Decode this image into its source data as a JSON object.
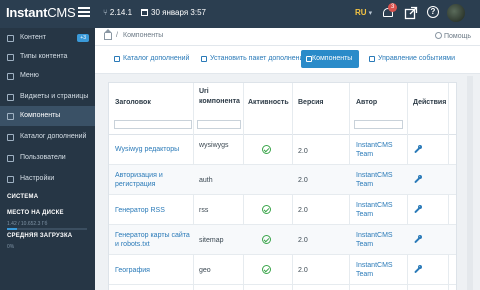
{
  "topbar": {
    "logo_main": "Instant",
    "logo_sub": "CMS",
    "version": "2.14.1",
    "date": "30 января 3:57",
    "language": "RU",
    "notifications_count": "3"
  },
  "sidebar": {
    "items": [
      {
        "label": "Контент",
        "badge": "+3"
      },
      {
        "label": "Типы контента"
      },
      {
        "label": "Меню"
      },
      {
        "label": "Виджеты и страницы"
      },
      {
        "label": "Компоненты"
      },
      {
        "label": "Каталог дополнений"
      },
      {
        "label": "Пользователи"
      },
      {
        "label": "Настройки"
      }
    ],
    "system_title": "СИСТЕМА",
    "disk_title": "МЕСТО НА ДИСКЕ",
    "disk_value": "1.42 / 10.652.3 Гб",
    "disk_fraction": 0.13,
    "load_title": "СРЕДНЯЯ ЗАГРУЗКА",
    "load_value": "0%",
    "load_fraction": 0.0
  },
  "breadcrumb": {
    "separator": "/",
    "current": "Компоненты",
    "help": "Помощь"
  },
  "tabs": [
    {
      "label": "Каталог дополнений"
    },
    {
      "label": "Установить пакет дополнения"
    },
    {
      "label": "Компоненты"
    },
    {
      "label": "Управление событиями"
    }
  ],
  "table": {
    "headers": {
      "title": "Заголовок",
      "uri": "Uri компонента",
      "active": "Активность",
      "version": "Версия",
      "author": "Автор",
      "actions": "Действия"
    },
    "rows": [
      {
        "title": "Wysiwyg редакторы",
        "uri": "wysiwygs",
        "active": true,
        "version": "2.0",
        "author": "InstantCMS Team"
      },
      {
        "title": "Авторизация и регистрация",
        "uri": "auth",
        "active": false,
        "version": "2.0",
        "author": "InstantCMS Team"
      },
      {
        "title": "Генератор RSS",
        "uri": "rss",
        "active": true,
        "version": "2.0",
        "author": "InstantCMS Team"
      },
      {
        "title": "Генератор карты сайта и robots.txt",
        "uri": "sitemap",
        "active": true,
        "version": "2.0",
        "author": "InstantCMS Team"
      },
      {
        "title": "География",
        "uri": "geo",
        "active": true,
        "version": "2.0",
        "author": "InstantCMS Team"
      }
    ]
  }
}
